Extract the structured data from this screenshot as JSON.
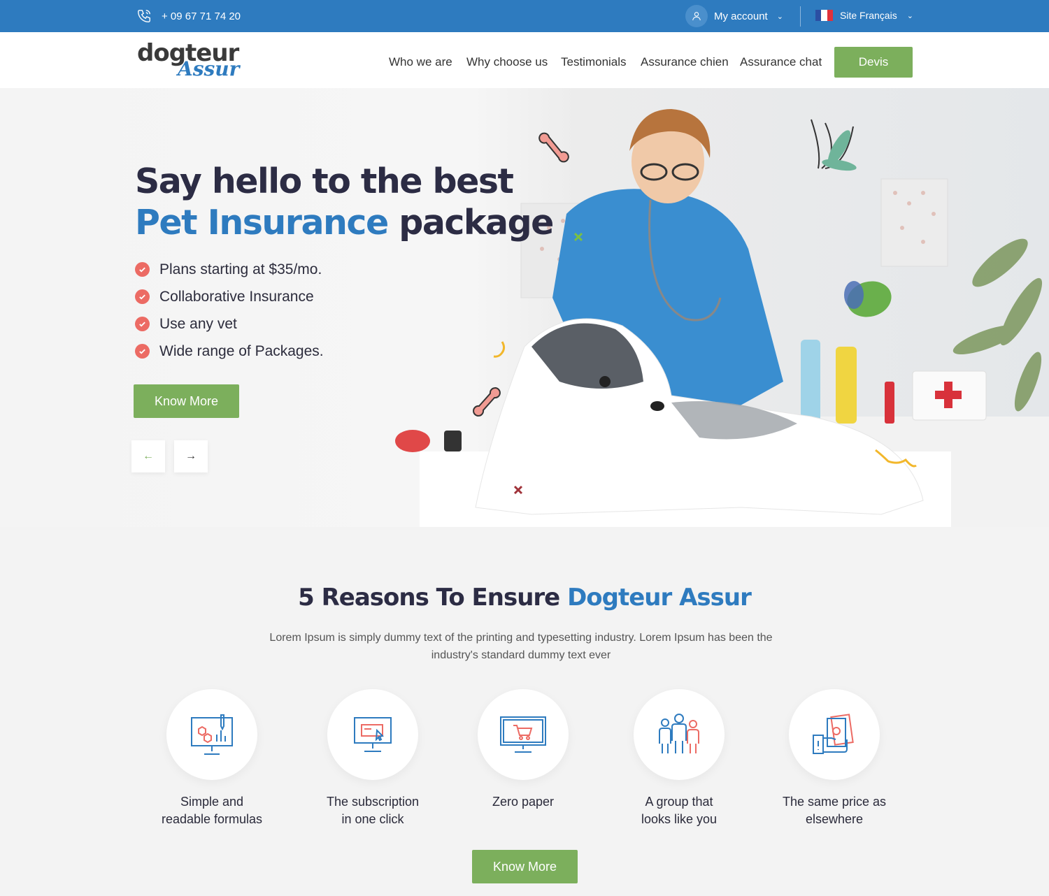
{
  "topbar": {
    "phone": "+ 09 67 71 74 20",
    "account": "My account",
    "language": "Site Français"
  },
  "brand": {
    "line1": "dogteur",
    "line2": "Assur"
  },
  "nav": {
    "items": [
      "Who we are",
      "Why choose us",
      "Testimonials",
      "Assurance chien",
      "Assurance chat"
    ],
    "cta": "Devis"
  },
  "hero": {
    "title_line1": "Say hello to the best",
    "title_highlight": "Pet Insurance",
    "title_rest": " package",
    "features": [
      "Plans starting at $35/mo.",
      "Collaborative Insurance",
      "Use any vet",
      "Wide range of Packages."
    ],
    "cta": "Know More",
    "prev_arrow": "←",
    "next_arrow": "→"
  },
  "reasons": {
    "title_prefix": "5 Reasons To Ensure ",
    "title_highlight": "Dogteur Assur",
    "description": "Lorem Ipsum is simply dummy text of the printing and typesetting industry. Lorem Ipsum has been the industry's standard dummy text ever",
    "items": [
      {
        "label_line1": "Simple and",
        "label_line2": "readable formulas",
        "icon": "presentation-chart-icon"
      },
      {
        "label_line1": "The subscription",
        "label_line2": "in one click",
        "icon": "monitor-click-icon"
      },
      {
        "label_line1": "Zero paper",
        "label_line2": "",
        "icon": "shopping-cart-monitor-icon"
      },
      {
        "label_line1": "A group that",
        "label_line2": "looks like you",
        "icon": "group-people-icon"
      },
      {
        "label_line1": "The same price as",
        "label_line2": "elsewhere",
        "icon": "money-hand-icon"
      }
    ],
    "cta": "Know More"
  },
  "colors": {
    "primary": "#2e7bbf",
    "accent": "#7caf5c",
    "check": "#ec6b64",
    "heading": "#2c2c44"
  }
}
